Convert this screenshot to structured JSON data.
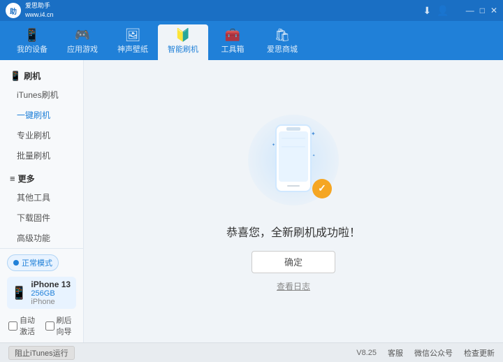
{
  "titleBar": {
    "logoText": "爱思助手\nwww.i4.cn",
    "logoShort": "助",
    "controls": {
      "minimize": "—",
      "maximize": "□",
      "close": "✕",
      "download": "⬇",
      "user": "👤"
    }
  },
  "navBar": {
    "items": [
      {
        "id": "my-device",
        "icon": "📱",
        "label": "我的设备"
      },
      {
        "id": "apps-games",
        "icon": "🎮",
        "label": "应用游戏"
      },
      {
        "id": "wallpaper",
        "icon": "🎨",
        "label": "神声壁纸"
      },
      {
        "id": "smart-flash",
        "icon": "🔰",
        "label": "智能刷机",
        "active": true
      },
      {
        "id": "tools",
        "icon": "🧰",
        "label": "工具箱"
      },
      {
        "id": "store",
        "icon": "🛍",
        "label": "爱思商城"
      }
    ]
  },
  "sidebar": {
    "sections": [
      {
        "title": "刷机",
        "titleIcon": "📱",
        "items": [
          {
            "id": "itunes-flash",
            "label": "iTunes刷机",
            "active": false
          },
          {
            "id": "one-click-flash",
            "label": "一键刷机",
            "active": true
          },
          {
            "id": "pro-flash",
            "label": "专业刷机",
            "active": false
          },
          {
            "id": "batch-flash",
            "label": "批量刷机",
            "active": false
          }
        ]
      },
      {
        "title": "更多",
        "titleIcon": "≡",
        "items": [
          {
            "id": "other-tools",
            "label": "其他工具",
            "active": false
          },
          {
            "id": "download-firmware",
            "label": "下载固件",
            "active": false
          },
          {
            "id": "advanced-features",
            "label": "高级功能",
            "active": false
          }
        ]
      }
    ],
    "device": {
      "mode": "正常模式",
      "name": "iPhone 13",
      "storage": "256GB",
      "model": "iPhone"
    },
    "checkboxes": [
      {
        "id": "auto-activate",
        "label": "自动激活",
        "checked": false
      },
      {
        "id": "guide-after",
        "label": "刷后向导",
        "checked": false
      }
    ]
  },
  "content": {
    "successTitle": "恭喜您，全新刷机成功啦！",
    "confirmButton": "确定",
    "viewLogLink": "查看日志"
  },
  "footer": {
    "stopItunesLabel": "阻止iTunes运行",
    "version": "V8.25",
    "links": [
      {
        "id": "support",
        "label": "客服"
      },
      {
        "id": "wechat",
        "label": "微信公众号"
      },
      {
        "id": "check-update",
        "label": "检查更新"
      }
    ]
  }
}
